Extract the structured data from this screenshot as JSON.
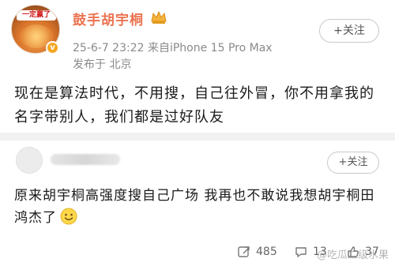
{
  "post": {
    "username": "鼓手胡宇桐",
    "avatar_banner": "一定赢了",
    "meta": "25-6-7 23:22  来自iPhone 15 Pro Max",
    "location": "发布于 北京",
    "follow_label": "+关注",
    "text": "现在是算法时代，不用搜，自己往外冒，你不用拿我的名字带别人，我们都是过好队友"
  },
  "comment": {
    "follow_label": "+关注",
    "text": "原来胡宇桐高强度搜自己广场 我再也不敢说我想胡宇桐田鸿杰了",
    "emoji": "smile-emoji"
  },
  "actions": {
    "repost_count": "485",
    "comment_count": "13",
    "like_count": "37"
  },
  "watermark": "@吃瓜二级水果",
  "colors": {
    "username": "#eb7350",
    "badge": "#f5a623"
  }
}
